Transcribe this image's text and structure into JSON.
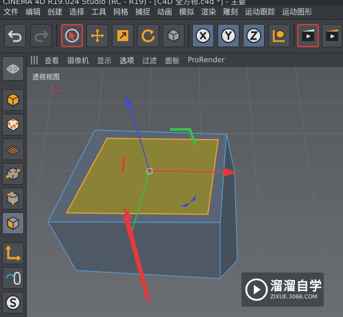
{
  "window": {
    "title": "CINEMA 4D R19.024 Studio (RC - R19) - [C4D 全方物.c4d *] - 主要"
  },
  "menu": [
    "文件",
    "编辑",
    "创建",
    "选择",
    "工具",
    "网格",
    "捕捉",
    "动画",
    "模拟",
    "渲染",
    "雕刻",
    "运动跟踪",
    "运动图形"
  ],
  "view_menu": [
    "查看",
    "摄像机",
    "显示",
    "选项",
    "过滤",
    "面板",
    "ProRender"
  ],
  "viewport": {
    "label": "透视视图"
  },
  "toolbar_icons": [
    "undo-icon",
    "redo-icon",
    "live-select-icon",
    "move-icon",
    "scale-icon",
    "rotate-icon",
    "recent-object-icon",
    "x-axis-lock-icon",
    "y-axis-lock-icon",
    "z-axis-lock-icon",
    "world-coordinates-icon",
    "render-view-icon",
    "render-to-picture-viewer-icon"
  ],
  "left_icons": [
    "make-editable-icon",
    "model-mode-icon",
    "texture-mode-icon",
    "workplane-mode-icon",
    "points-mode-icon",
    "edges-mode-icon",
    "polygons-mode-icon",
    "axis-mode-icon",
    "tweak-mode-icon",
    "snap-icon"
  ],
  "watermark": {
    "title": "溜溜自学",
    "subtitle": "ZIXUE.3066.COM"
  },
  "colors": {
    "x_axis": "#e53a3a",
    "y_axis": "#36c14a",
    "z_axis": "#3a4ce0",
    "selected_face": "#8a8335",
    "selection_outline": "#f2a533"
  }
}
